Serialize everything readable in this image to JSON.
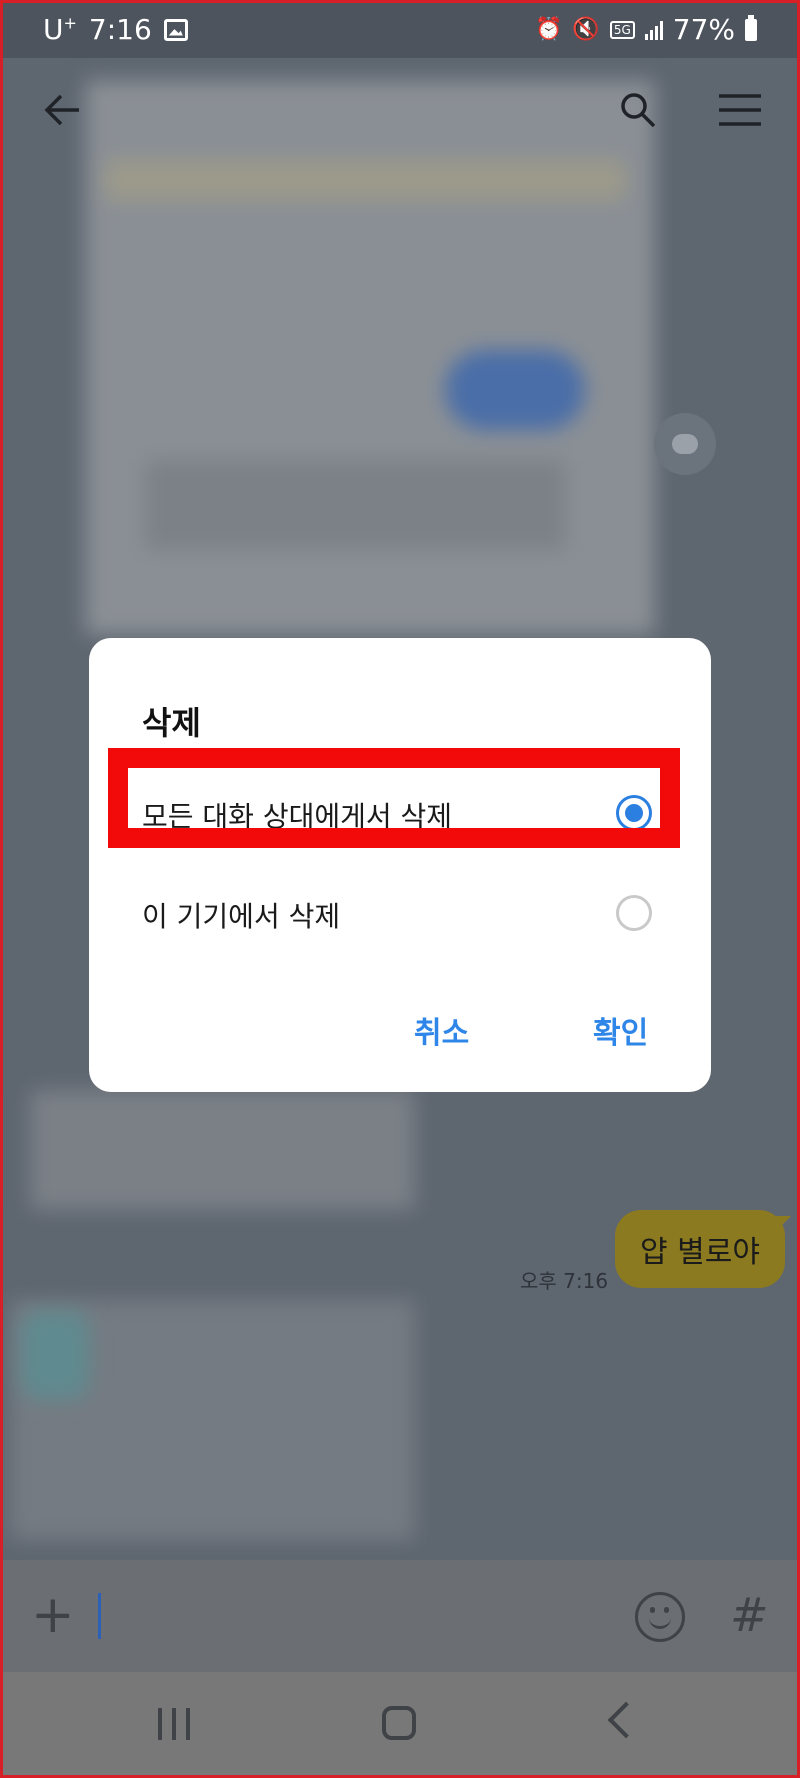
{
  "status_bar": {
    "carrier": "U",
    "carrier_sup": "+",
    "time": "7:16",
    "network": "5G",
    "battery": "77%"
  },
  "icons": {
    "back": "arrow-left-icon",
    "search": "search-icon",
    "menu": "hamburger-menu-icon",
    "share": "chat-bubble-icon",
    "plus": "plus-icon",
    "emoji": "emoji-icon",
    "hash": "hashtag-icon"
  },
  "dialog": {
    "title": "삭제",
    "options": [
      {
        "label": "모든 대화 상대에게서 삭제",
        "selected": true
      },
      {
        "label": "이 기기에서 삭제",
        "selected": false
      }
    ],
    "cancel_label": "취소",
    "confirm_label": "확인"
  },
  "chat": {
    "my_message": "얍 별로야",
    "my_message_time": "오후 7:16"
  },
  "colors": {
    "accent": "#2b7fe0",
    "highlight": "#f20a0a",
    "my_bubble": "#8b7a1f"
  }
}
